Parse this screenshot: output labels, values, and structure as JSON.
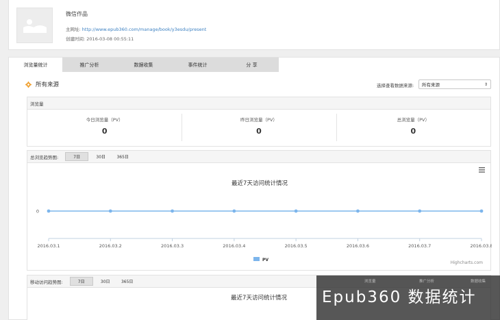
{
  "book": {
    "title": "微信作品",
    "url_label": "主网址:",
    "url": "http://www.epub360.com/manage/book/y3esdu/present",
    "created_label": "创建时间:",
    "created": "2016-03-08 00:55:11"
  },
  "tabs": [
    {
      "label": "浏览量统计",
      "active": true
    },
    {
      "label": "推广分析",
      "active": false
    },
    {
      "label": "数据收集",
      "active": false
    },
    {
      "label": "事件统计",
      "active": false
    },
    {
      "label": "分 享",
      "active": false
    }
  ],
  "source": {
    "title": "所有来源",
    "select_label": "选择查看数据来源:",
    "selected": "所有来源"
  },
  "pv_panel": {
    "header": "浏览量",
    "cols": [
      {
        "label": "今日浏览量（PV）",
        "value": "0"
      },
      {
        "label": "昨日浏览量（PV）",
        "value": "0"
      },
      {
        "label": "总浏览量（PV）",
        "value": "0"
      }
    ]
  },
  "trend_panel": {
    "header": "总浏览趋势图:",
    "ranges": [
      "7日",
      "30日",
      "365日"
    ]
  },
  "mobile_panel": {
    "header": "移动访问趋势图:",
    "ranges": [
      "7日",
      "30日",
      "365日"
    ],
    "chart_title": "最近7天访问统计情况"
  },
  "chart_data": {
    "type": "line",
    "title": "最近7天访问统计情况",
    "x": [
      "2016.03.1",
      "2016.03.2",
      "2016.03.3",
      "2016.03.4",
      "2016.03.5",
      "2016.03.6",
      "2016.03.7",
      "2016.03.8"
    ],
    "series": [
      {
        "name": "PV",
        "values": [
          0,
          0,
          0,
          0,
          0,
          0,
          0,
          0
        ]
      }
    ],
    "y_ticks": [
      "0"
    ],
    "legend": "bottom-center",
    "credit": "Highcharts.com",
    "color": "#7cb5ec"
  },
  "overlay": {
    "text": "Epub360 数据统计",
    "ghost_tabs": [
      "浏览量",
      "推广分析",
      "数据收集"
    ]
  }
}
